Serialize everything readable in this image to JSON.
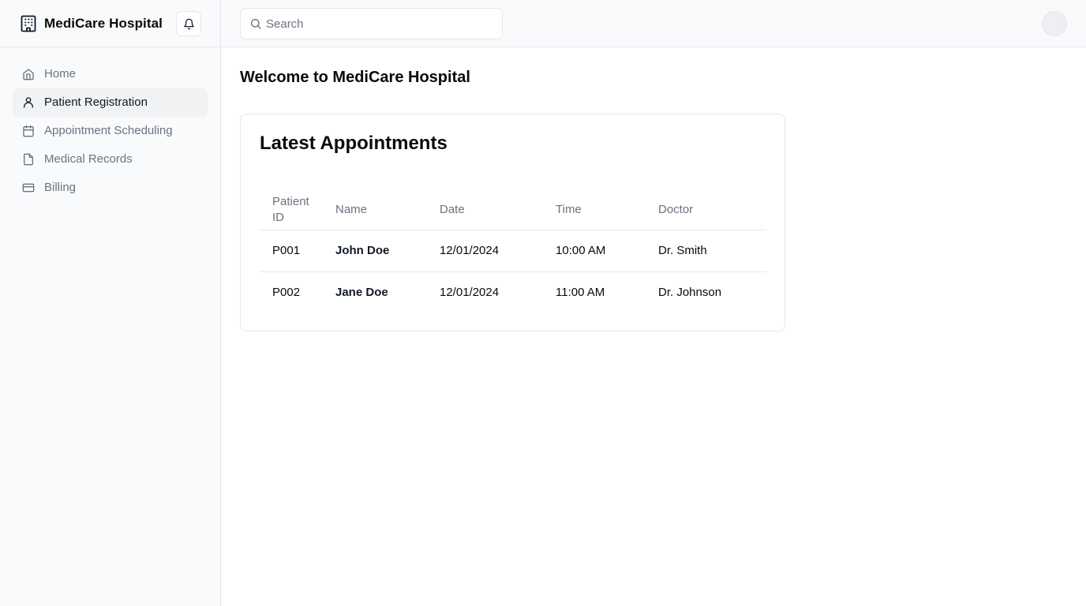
{
  "app": {
    "title": "MediCare Hospital",
    "brand_icon": "hospital-building-icon",
    "notification_icon": "bell-icon"
  },
  "sidebar": {
    "items": [
      {
        "label": "Home",
        "icon": "home-icon",
        "active": false
      },
      {
        "label": "Patient Registration",
        "icon": "user-icon",
        "active": true
      },
      {
        "label": "Appointment Scheduling",
        "icon": "calendar-icon",
        "active": false
      },
      {
        "label": "Medical Records",
        "icon": "file-icon",
        "active": false
      },
      {
        "label": "Billing",
        "icon": "credit-card-icon",
        "active": false
      }
    ]
  },
  "search": {
    "placeholder": "Search",
    "value": ""
  },
  "main": {
    "welcome": "Welcome to MediCare Hospital",
    "card_title": "Latest Appointments",
    "table": {
      "headers": [
        "Patient ID",
        "Name",
        "Date",
        "Time",
        "Doctor"
      ],
      "rows": [
        {
          "patient_id": "P001",
          "name": "John Doe",
          "date": "12/01/2024",
          "time": "10:00 AM",
          "doctor": "Dr. Smith"
        },
        {
          "patient_id": "P002",
          "name": "Jane Doe",
          "date": "12/01/2024",
          "time": "11:00 AM",
          "doctor": "Dr. Johnson"
        }
      ]
    }
  },
  "colors": {
    "sidebar_bg": "#f9fafb",
    "border": "#e5e7eb",
    "muted_text": "#6b7280",
    "active_bg": "#f1f2f4"
  }
}
